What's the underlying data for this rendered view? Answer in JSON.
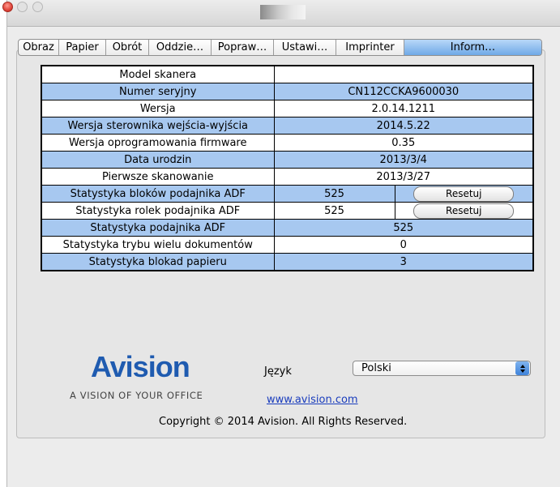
{
  "tabs": [
    {
      "label": "Obraz",
      "active": false
    },
    {
      "label": "Papier",
      "active": false
    },
    {
      "label": "Obrót",
      "active": false
    },
    {
      "label": "Oddzie…",
      "active": false
    },
    {
      "label": "Popraw…",
      "active": false
    },
    {
      "label": "Ustawi…",
      "active": false
    },
    {
      "label": "Imprinter",
      "active": false
    },
    {
      "label": "Inform…",
      "active": true
    }
  ],
  "info_rows": [
    {
      "label": "Model skanera",
      "value": ""
    },
    {
      "label": "Numer seryjny",
      "value": "CN112CCKA9600030"
    },
    {
      "label": "Wersja",
      "value": "2.0.14.1211"
    },
    {
      "label": "Wersja sterownika wejścia-wyjścia",
      "value": "2014.5.22"
    },
    {
      "label": "Wersja oprogramowania firmware",
      "value": "0.35"
    },
    {
      "label": "Data urodzin",
      "value": "2013/3/4"
    },
    {
      "label": "Pierwsze skanowanie",
      "value": "2013/3/27"
    },
    {
      "label": "Statystyka bloków podajnika ADF",
      "value": "525",
      "button": "Resetuj"
    },
    {
      "label": "Statystyka rolek podajnika ADF",
      "value": "525",
      "button": "Resetuj"
    },
    {
      "label": "Statystyka podajnika ADF",
      "value": "525"
    },
    {
      "label": "Statystyka trybu wielu dokumentów",
      "value": "0"
    },
    {
      "label": "Statystyka blokad papieru",
      "value": "3"
    }
  ],
  "footer": {
    "logo_text": "Avision",
    "tagline": "A VISION OF YOUR OFFICE",
    "language_label": "Język",
    "language_value": "Polski",
    "website": "www.avision.com",
    "copyright": "Copyright © 2014 Avision. All Rights Reserved."
  },
  "colors": {
    "row_highlight": "#a7c8f0",
    "active_tab": "#6fa9e7",
    "brand": "#1f5bb0",
    "link": "#1a3dbd"
  }
}
